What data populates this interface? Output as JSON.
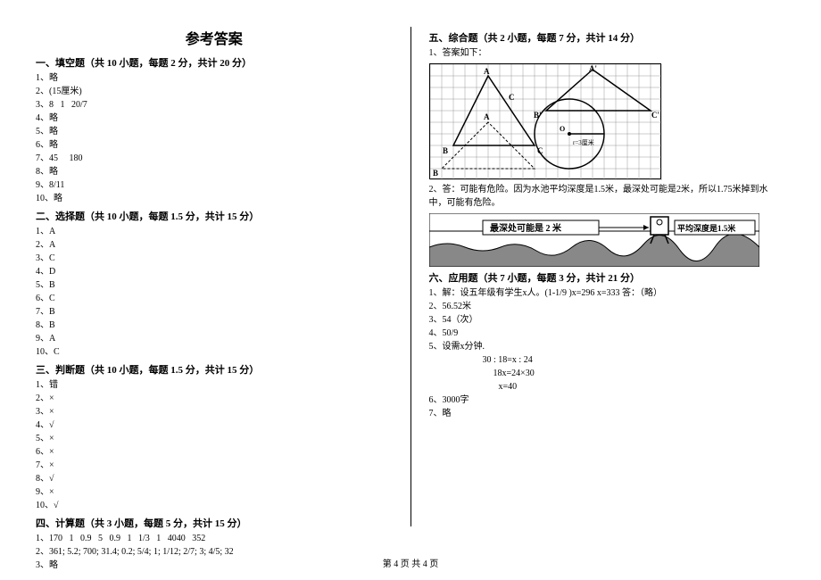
{
  "title": "参考答案",
  "footer": "第 4 页 共 4 页",
  "left": {
    "s1": {
      "title": "一、填空题（共 10 小题，每题 2 分，共计 20 分）",
      "l1": "1、略",
      "l2": "2、(15厘米)",
      "l3": "3、8   1   20/7",
      "l4": "4、略",
      "l5": "5、略",
      "l6": "6、略",
      "l7": "7、45     180",
      "l8": "8、略",
      "l9": "9、8/11",
      "l10": "10、略"
    },
    "s2": {
      "title": "二、选择题（共 10 小题，每题 1.5 分，共计 15 分）",
      "l1": "1、A",
      "l2": "2、A",
      "l3": "3、C",
      "l4": "4、D",
      "l5": "5、B",
      "l6": "6、C",
      "l7": "7、B",
      "l8": "8、B",
      "l9": "9、A",
      "l10": "10、C"
    },
    "s3": {
      "title": "三、判断题（共 10 小题，每题 1.5 分，共计 15 分）",
      "l1": "1、错",
      "l2": "2、×",
      "l3": "3、×",
      "l4": "4、√",
      "l5": "5、×",
      "l6": "6、×",
      "l7": "7、×",
      "l8": "8、√",
      "l9": "9、×",
      "l10": "10、√"
    },
    "s4": {
      "title": "四、计算题（共 3 小题，每题 5 分，共计 15 分）",
      "l1": "1、170   1   0.9   5   0.9   1   1/3   1   4040   352",
      "l2": "2、361; 5.2; 700; 31.4; 0.2; 5/4; 1; 1/12; 2/7; 3; 4/5; 32",
      "l3": "3、略"
    }
  },
  "right": {
    "s5": {
      "title": "五、综合题（共 2 小题，每题 7 分，共计 14 分）",
      "l1": "1、答案如下：",
      "l2": "2、答：可能有危险。因为水池平均深度是1.5米，最深处可能是2米，所以1.75米掉到水中，可能有危险。",
      "water_left": "最深处可能是 2 米",
      "water_right": "平均深度是 1.5 米"
    },
    "s6": {
      "title": "六、应用题（共 7 小题，每题 3 分，共计 21 分）",
      "l1": "1、解：设五年级有学生x人。(1-1/9 )x=296 x=333 答：（略）",
      "l2": "2、56.52米",
      "l3": "3、54（次）",
      "l4": "4、50/9",
      "l5": "5、设需x分钟.",
      "l5a": "30 : 18=x : 24",
      "l5b": "18x=24×30",
      "l5c": "x=40",
      "l6": "6、3000字",
      "l7": "7、略"
    }
  },
  "grid_labels": {
    "A": "A",
    "A2": "A'",
    "B": "B",
    "B2": "B'",
    "C": "C",
    "C2": "C'",
    "O": "O",
    "radius": "r=3厘米"
  }
}
